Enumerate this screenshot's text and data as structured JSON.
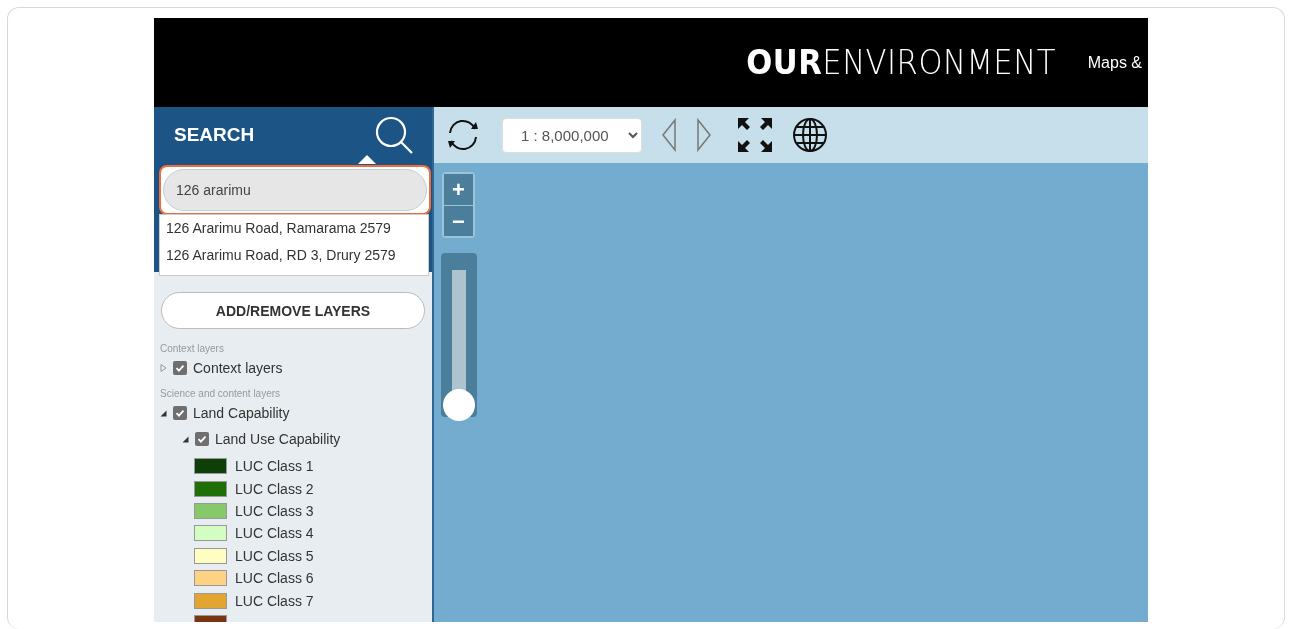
{
  "header": {
    "logo": "**OUR**ENVIRONMENT",
    "nav_link": "Maps &"
  },
  "search": {
    "title": "SEARCH",
    "value": "126 ararimu",
    "suggestions": [
      "126 Ararimu Road, Ramarama 2579",
      "126 Ararimu Road, RD 3, Drury 2579"
    ]
  },
  "layers": {
    "button": "ADD/REMOVE LAYERS",
    "groups": [
      {
        "heading": "Context layers",
        "items": [
          {
            "label": "Context layers",
            "checked": true,
            "expanded": false
          }
        ]
      },
      {
        "heading": "Science and content layers",
        "items": [
          {
            "label": "Land Capability",
            "checked": true,
            "expanded": true,
            "children": [
              {
                "label": "Land Use Capability",
                "checked": true,
                "expanded": true,
                "legend": [
                  {
                    "label": "LUC Class 1",
                    "color": "#0e3f08"
                  },
                  {
                    "label": "LUC Class 2",
                    "color": "#1f6e08"
                  },
                  {
                    "label": "LUC Class 3",
                    "color": "#85c96a"
                  },
                  {
                    "label": "LUC Class 4",
                    "color": "#d4fdc4"
                  },
                  {
                    "label": "LUC Class 5",
                    "color": "#fefec3"
                  },
                  {
                    "label": "LUC Class 6",
                    "color": "#fed283"
                  },
                  {
                    "label": "LUC Class 7",
                    "color": "#e2a52f"
                  },
                  {
                    "color": "#7a3510"
                  }
                ]
              }
            ]
          }
        ]
      }
    ]
  },
  "toolbar": {
    "scale": "1 : 8,000,000"
  },
  "zoom": {
    "plus": "+",
    "minus": "−",
    "level": 0
  }
}
